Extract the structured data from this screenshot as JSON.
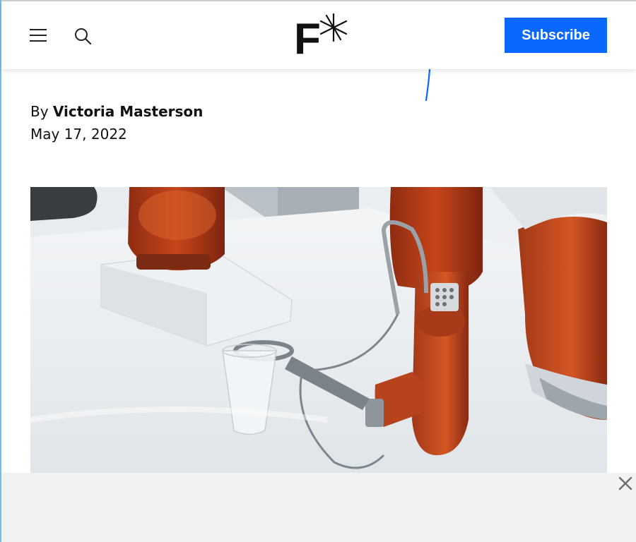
{
  "header": {
    "menu_icon": "hamburger-menu-icon",
    "search_icon": "search-icon",
    "logo_text": "F",
    "logo_mark": "asterisk",
    "subscribe_label": "Subscribe"
  },
  "article": {
    "byline_prefix": "By",
    "author": "Victoria Masterson",
    "date": "May 17, 2022"
  },
  "hero_image": {
    "description_icon": "robot-arm-photo"
  },
  "ad": {
    "close_icon": "close-icon"
  },
  "colors": {
    "accent": "#0b68ff",
    "robot_orange": "#c7451a",
    "ad_background": "#f2f2f2"
  }
}
